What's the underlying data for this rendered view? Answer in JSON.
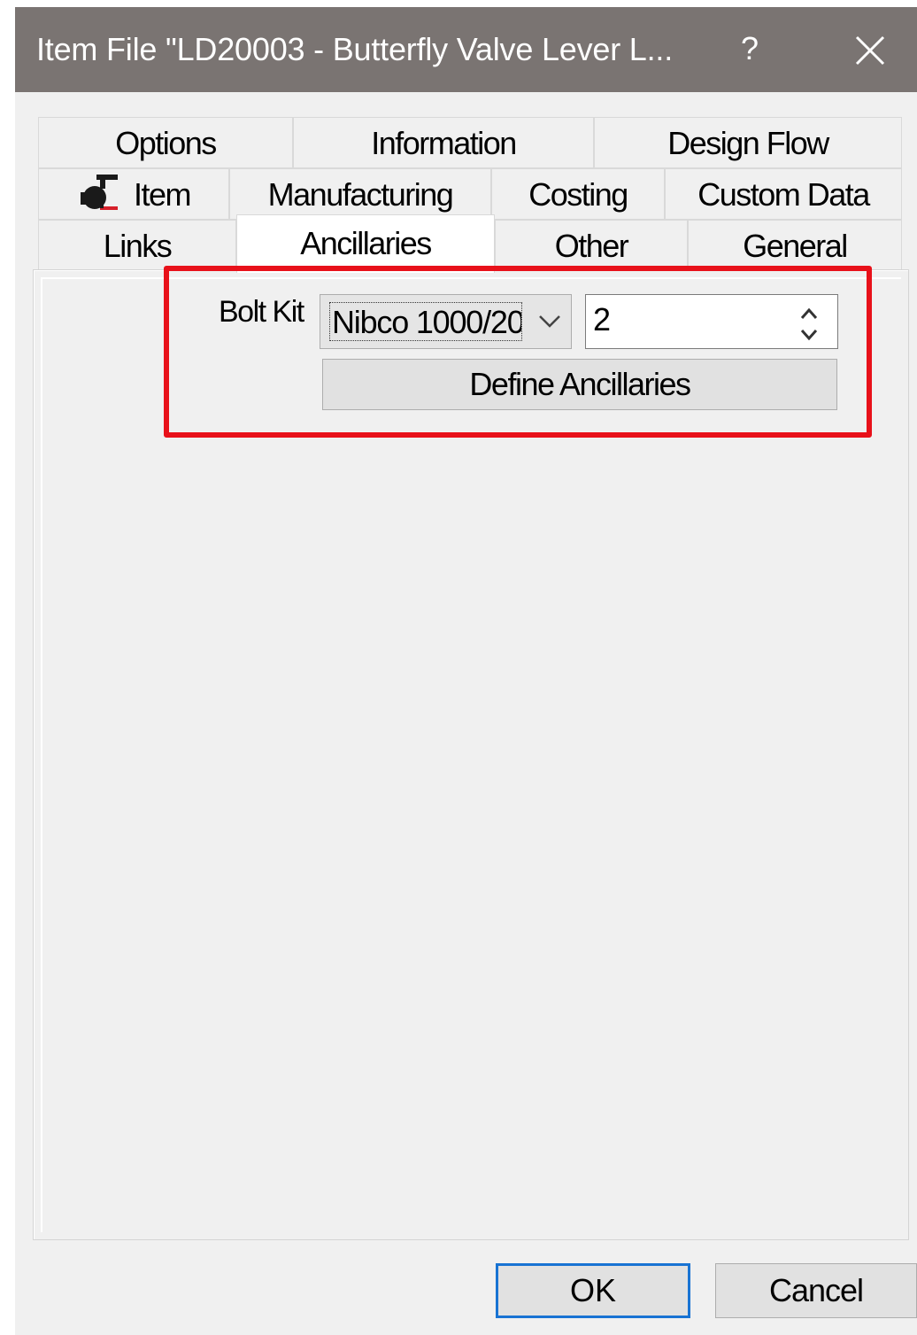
{
  "window": {
    "title": "Item File \"LD20003 - Butterfly Valve Lever L...",
    "help_label": "?",
    "close_icon": "close-icon"
  },
  "tabs": {
    "row1": [
      {
        "label": "Options"
      },
      {
        "label": "Information"
      },
      {
        "label": "Design Flow"
      }
    ],
    "row2": [
      {
        "label": "Item",
        "icon": "valve-icon"
      },
      {
        "label": "Manufacturing"
      },
      {
        "label": "Costing"
      },
      {
        "label": "Custom Data"
      }
    ],
    "row3": [
      {
        "label": "Links"
      },
      {
        "label": "Ancillaries",
        "active": true
      },
      {
        "label": "Other"
      },
      {
        "label": "General"
      }
    ]
  },
  "ancillaries": {
    "bolt_kit_label": "Bolt Kit",
    "bolt_kit_value": "Nibco 1000/20",
    "quantity": "2",
    "define_button": "Define Ancillaries"
  },
  "highlight_color": "#e8111a",
  "footer": {
    "ok": "OK",
    "cancel": "Cancel"
  }
}
